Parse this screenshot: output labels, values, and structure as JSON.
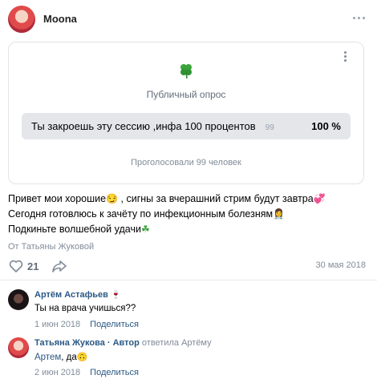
{
  "post": {
    "author": "Moona",
    "poll": {
      "icon": "four-leaf-clover-icon",
      "title": "Публичный опрос",
      "option_text": "Ты закроешь эту сессию ,инфа 100 процентов",
      "option_votes": "99",
      "option_percent": "100 %",
      "option_share": 1.0,
      "voted_summary": "Проголосовали 99 человек"
    },
    "text_line1": "Привет мои хорошие",
    "text_line1_tail": " , сигны за вчерашний стрим будут завтра",
    "text_line2": "Сегодня готовлюсь к зачёту по инфекционным болезням",
    "text_line3": "Подкиньте волшебной удачи",
    "signer": "От Татьяны Жуковой",
    "likes": "21",
    "date": "30 мая 2018"
  },
  "comments": [
    {
      "author": "Артём Астафьев",
      "text": "Ты на врача учишься??",
      "date": "1 июн 2018",
      "share_label": "Поделиться"
    },
    {
      "author": "Татьяна Жукова · Автор",
      "reply_to": "ответила Артёму",
      "mention": "Артем",
      "text": ", да",
      "date": "2 июн 2018",
      "share_label": "Поделиться"
    }
  ],
  "colors": {
    "link": "#2a5885",
    "muted": "#818c99",
    "clover": "#37a13a",
    "poll_bar": "#e9ebee"
  }
}
